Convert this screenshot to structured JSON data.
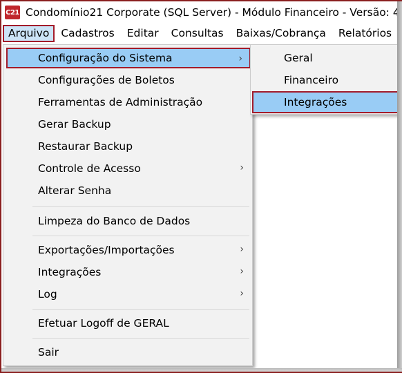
{
  "window": {
    "icon_text": "C21",
    "title": "Condomínio21 Corporate  (SQL Server)  - Módulo Financeiro - Versão: 4"
  },
  "menubar": {
    "items": [
      "Arquivo",
      "Cadastros",
      "Editar",
      "Consultas",
      "Baixas/Cobrança",
      "Relatórios"
    ]
  },
  "arquivo_menu": {
    "items": [
      {
        "label": "Configuração do Sistema",
        "submenu": true
      },
      {
        "label": "Configurações de Boletos",
        "submenu": false
      },
      {
        "label": "Ferramentas de Administração",
        "submenu": false
      },
      {
        "label": "Gerar Backup",
        "submenu": false
      },
      {
        "label": "Restaurar Backup",
        "submenu": false
      },
      {
        "label": "Controle de Acesso",
        "submenu": true
      },
      {
        "label": "Alterar Senha",
        "submenu": false
      },
      {
        "label": "Limpeza do Banco de Dados",
        "submenu": false
      },
      {
        "label": "Exportações/Importações",
        "submenu": true
      },
      {
        "label": "Integrações",
        "submenu": true
      },
      {
        "label": "Log",
        "submenu": true
      },
      {
        "label": "Efetuar Logoff de GERAL",
        "submenu": false
      },
      {
        "label": "Sair",
        "submenu": false
      }
    ]
  },
  "config_submenu": {
    "items": [
      "Geral",
      "Financeiro",
      "Integrações"
    ]
  },
  "highlight_color": "#99ccf5",
  "outline_color": "#a31b2a"
}
